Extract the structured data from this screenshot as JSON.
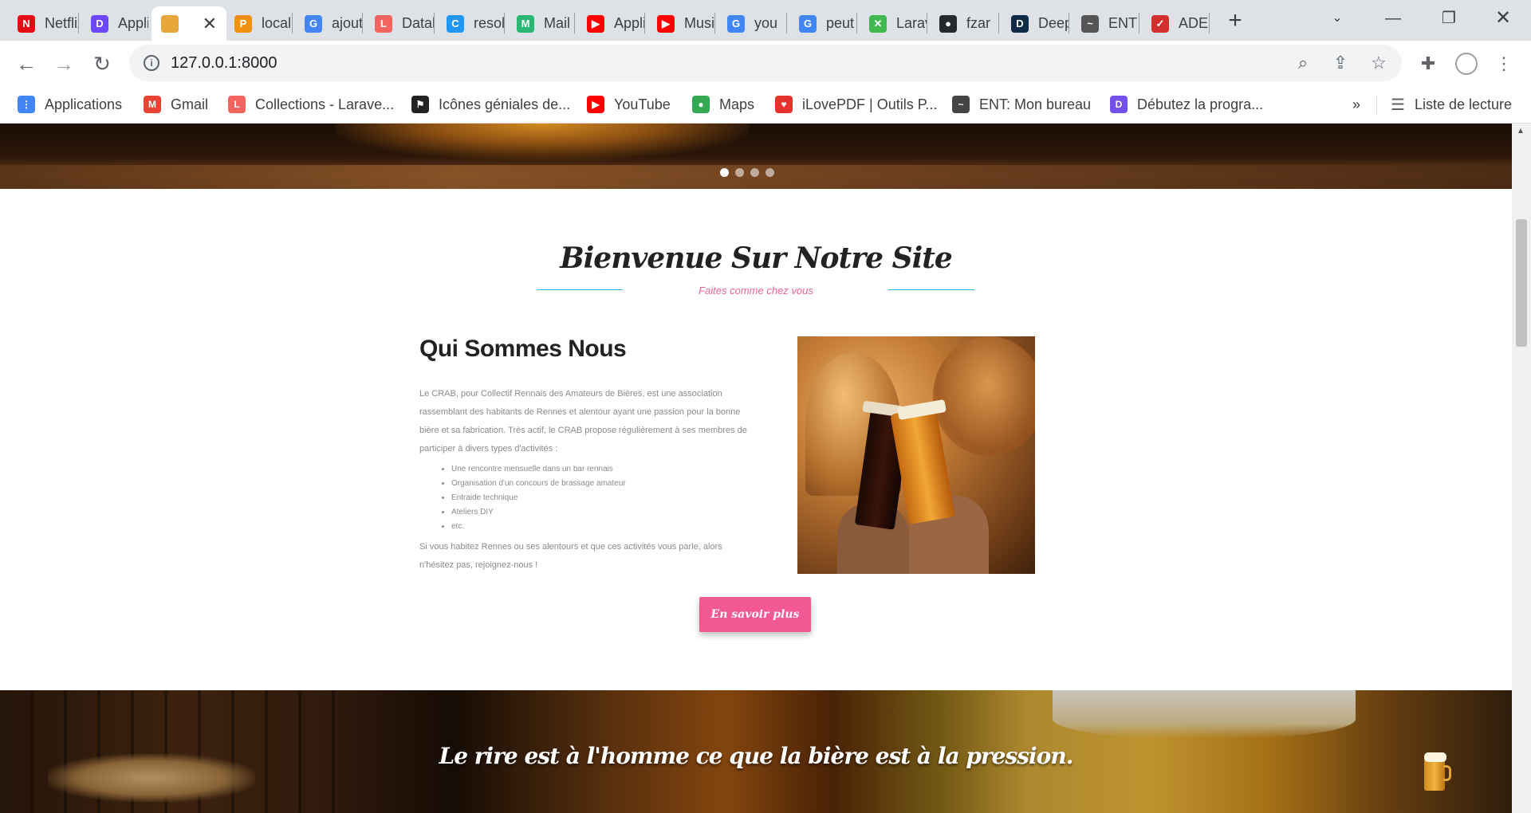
{
  "browser": {
    "tabs": [
      {
        "label": "Netflix",
        "icon": "netflix-icon",
        "color": "#e50914",
        "glyph": "N"
      },
      {
        "label": "Applications",
        "icon": "app-icon",
        "color": "#6c47ff",
        "glyph": "D"
      },
      {
        "label": "",
        "icon": "beer-tab-icon",
        "color": "#e8a73a",
        "glyph": "",
        "active": true
      },
      {
        "label": "localhost",
        "icon": "phpmyadmin-icon",
        "color": "#f29111",
        "glyph": "P"
      },
      {
        "label": "ajouter",
        "icon": "google-icon",
        "color": "#4285f4",
        "glyph": "G"
      },
      {
        "label": "Database",
        "icon": "laravel-icon",
        "color": "#f4645f",
        "glyph": "L"
      },
      {
        "label": "resolve",
        "icon": "c-icon",
        "color": "#2196f3",
        "glyph": "C"
      },
      {
        "label": "Mail",
        "icon": "mail-icon",
        "color": "#2bb673",
        "glyph": "M"
      },
      {
        "label": "Applications",
        "icon": "youtube-icon",
        "color": "#ff0000",
        "glyph": "▶"
      },
      {
        "label": "Music",
        "icon": "youtube-icon",
        "color": "#ff0000",
        "glyph": "▶"
      },
      {
        "label": "you",
        "icon": "google-icon",
        "color": "#4285f4",
        "glyph": "G"
      },
      {
        "label": "peut",
        "icon": "google-icon",
        "color": "#4285f4",
        "glyph": "G"
      },
      {
        "label": "Laravel",
        "icon": "laravel-cross-icon",
        "color": "#3fb950",
        "glyph": "✕"
      },
      {
        "label": "fzar",
        "icon": "github-icon",
        "color": "#24292e",
        "glyph": "●"
      },
      {
        "label": "Deep",
        "icon": "deepl-icon",
        "color": "#0f2b46",
        "glyph": "D"
      },
      {
        "label": "ENT",
        "icon": "ent-icon",
        "color": "#555555",
        "glyph": "~"
      },
      {
        "label": "ADE",
        "icon": "ade-icon",
        "color": "#d32f2f",
        "glyph": "✓"
      }
    ],
    "url": "127.0.0.1:8000",
    "bookmarks": [
      {
        "label": "Applications",
        "icon": "apps-grid-icon",
        "color": "#4285f4",
        "glyph": "⋮"
      },
      {
        "label": "Gmail",
        "icon": "gmail-icon",
        "color": "#ea4335",
        "glyph": "M"
      },
      {
        "label": "Collections - Larave...",
        "icon": "laravel-icon",
        "color": "#f4645f",
        "glyph": "L"
      },
      {
        "label": "Icônes géniales de...",
        "icon": "fontawesome-icon",
        "color": "#222222",
        "glyph": "⚑"
      },
      {
        "label": "YouTube",
        "icon": "youtube-icon",
        "color": "#ff0000",
        "glyph": "▶"
      },
      {
        "label": "Maps",
        "icon": "maps-icon",
        "color": "#34a853",
        "glyph": "●"
      },
      {
        "label": "iLovePDF | Outils P...",
        "icon": "ilovepdf-icon",
        "color": "#e5322d",
        "glyph": "♥"
      },
      {
        "label": "ENT: Mon bureau",
        "icon": "ent-icon",
        "color": "#444444",
        "glyph": "~"
      },
      {
        "label": "Débutez la progra...",
        "icon": "openclassrooms-icon",
        "color": "#7451eb",
        "glyph": "D"
      }
    ],
    "reading_list": "Liste de lecture",
    "more_bookmarks": "»"
  },
  "page": {
    "welcome_title": "Bienvenue Sur Notre Site",
    "welcome_subtitle": "Faites comme chez vous",
    "about_title": "Qui Sommes Nous",
    "about_text": "Le CRAB, pour Collectif Rennais des Amateurs de Bières, est une association rassemblant des habitants de Rennes et alentour ayant une passion pour la bonne bière et sa fabrication. Très actif, le CRAB propose régulièrement à ses membres de participer à divers types d'activités :",
    "activities": [
      "Une rencontre mensuelle dans un bar rennais",
      "Organisation d'un concours de brassage amateur",
      "Entraide technique",
      "Ateliers DIY",
      "etc."
    ],
    "about_outro": "Si vous habitez Rennes ou ses alentours et que ces activités vous parle, alors n'hésitez pas, rejoignez-nous !",
    "more_button": "En savoir plus",
    "quote": "Le rire est à l'homme ce que la bière est à la pression.",
    "slider_dots": 4,
    "accent_pink": "#f25891",
    "accent_blue": "#29b6f6"
  }
}
